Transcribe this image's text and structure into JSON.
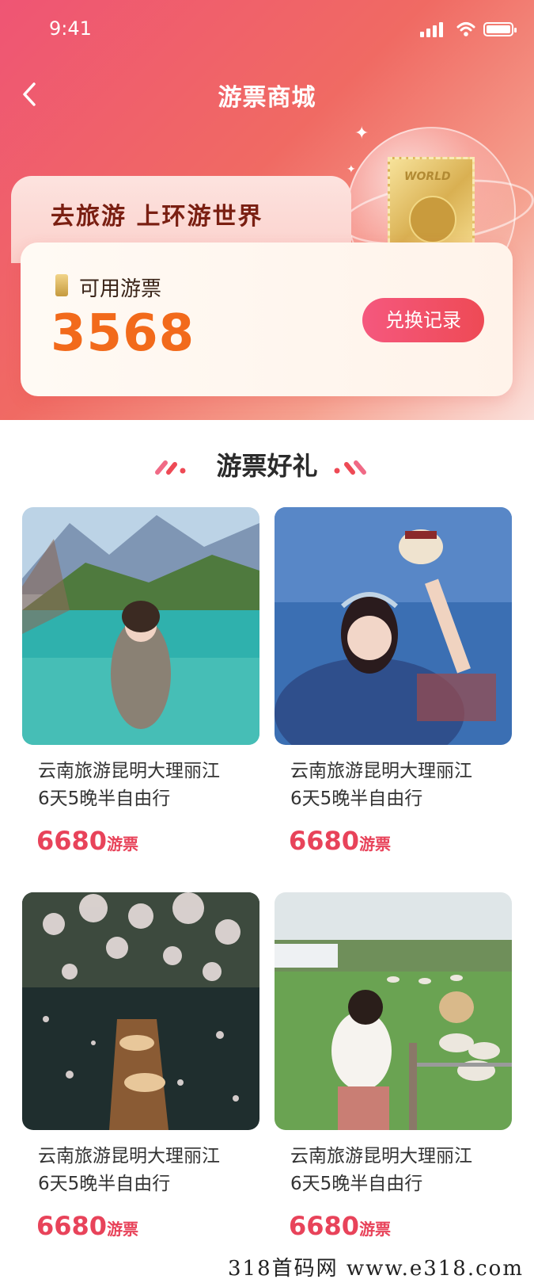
{
  "status_bar": {
    "time": "9:41"
  },
  "header": {
    "title": "游票商城"
  },
  "banner": {
    "slogan": "去旅游 上环游世界",
    "ticket_text": "WORLD",
    "balance_label": "可用游票",
    "balance_value": "3568",
    "history_button": "兑换记录"
  },
  "section": {
    "title": "游票好礼"
  },
  "products": [
    {
      "title_line1": "云南旅游昆明大理丽江",
      "title_line2": "6天5晚半自由行",
      "price": "6680",
      "unit": "游票"
    },
    {
      "title_line1": "云南旅游昆明大理丽江",
      "title_line2": "6天5晚半自由行",
      "price": "6680",
      "unit": "游票"
    },
    {
      "title_line1": "云南旅游昆明大理丽江",
      "title_line2": "6天5晚半自由行",
      "price": "6680",
      "unit": "游票"
    },
    {
      "title_line1": "云南旅游昆明大理丽江",
      "title_line2": "6天5晚半自由行",
      "price": "6680",
      "unit": "游票"
    }
  ],
  "footer": {
    "watermark": "318首码网  www.e318.com"
  },
  "colors": {
    "accent": "#ee4a55",
    "price": "#e8435a",
    "balance": "#f26a1b"
  }
}
